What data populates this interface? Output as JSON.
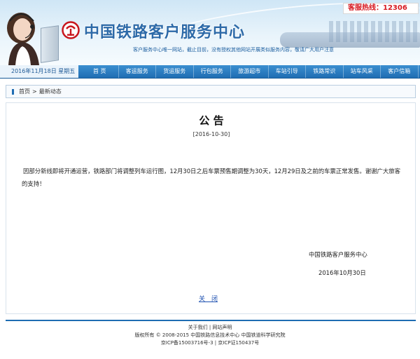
{
  "header": {
    "site_title": "中国铁路客户服务中心",
    "hotline": "客服热线：12306",
    "notice": "客户服务中心唯一网站，截止目前，没有授权其他网站开展类似服务内容，敬请广大用户注意"
  },
  "nav": {
    "date": "2016年11月18日 星期五",
    "items": [
      "首 页",
      "客运服务",
      "货运服务",
      "行包服务",
      "旅游超市",
      "车站引导",
      "铁路常识",
      "站车风采",
      "客户信箱"
    ]
  },
  "breadcrumb": {
    "home": "首页",
    "separator": ">",
    "current": "最新动态"
  },
  "announcement": {
    "title": "公 告",
    "date": "[2016-10-30]",
    "body": "因部分新线即将开通运营，铁路部门将调整列车运行图，12月30日之后车票预售期调整为30天，12月29日及之前的车票正常发售。谢谢广大旅客的支持！",
    "signature": "中国铁路客户服务中心",
    "sign_date": "2016年10月30日",
    "close_label": "关　闭"
  },
  "footer": {
    "about": "关于我们",
    "divider": "|",
    "statement": "网站声明",
    "copyright": "版权所有 © 2008-2015 中国铁路信息技术中心 中国铁道科学研究院",
    "icp": "京ICP备15003716号-3 | 京ICP证150437号"
  },
  "colors": {
    "primary": "#1f6db3",
    "hotline_red": "#d71920",
    "title_blue": "#2d6aa8"
  }
}
